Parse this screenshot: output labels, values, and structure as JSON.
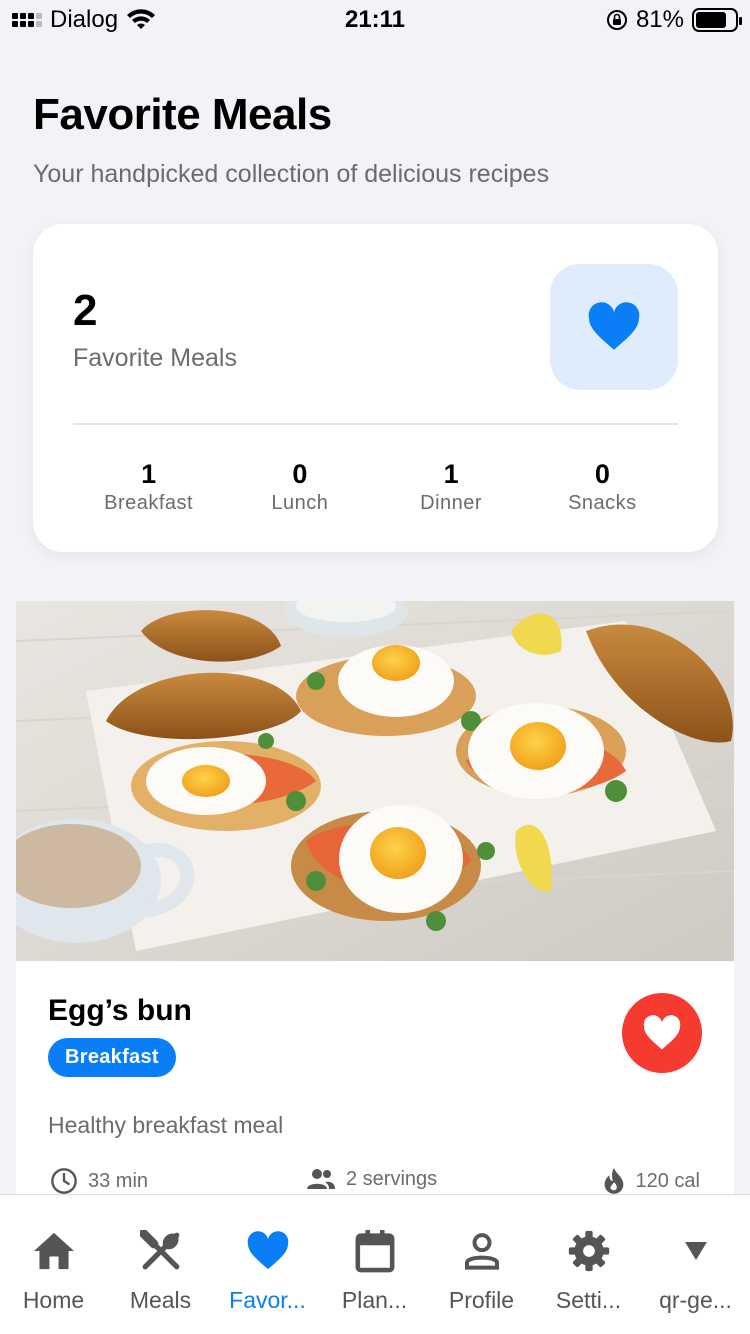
{
  "status_bar": {
    "carrier": "Dialog",
    "time": "21:11",
    "battery_percent": "81%",
    "battery_level": 0.81
  },
  "header": {
    "title": "Favorite Meals",
    "subtitle": "Your handpicked collection of delicious recipes"
  },
  "summary": {
    "count": "2",
    "count_label": "Favorite Meals",
    "stats": [
      {
        "value": "1",
        "label": "Breakfast"
      },
      {
        "value": "0",
        "label": "Lunch"
      },
      {
        "value": "1",
        "label": "Dinner"
      },
      {
        "value": "0",
        "label": "Snacks"
      }
    ]
  },
  "meals": [
    {
      "title": "Egg’s bun",
      "category": "Breakfast",
      "description": "Healthy breakfast meal",
      "time": "33 min",
      "servings": "2 servings",
      "calories": "120 cal",
      "favorite": true
    }
  ],
  "tabs": [
    {
      "label": "Home",
      "icon": "home-icon"
    },
    {
      "label": "Meals",
      "icon": "fork-knife-icon"
    },
    {
      "label": "Favor...",
      "icon": "heart-icon",
      "active": true
    },
    {
      "label": "Plan...",
      "icon": "calendar-icon"
    },
    {
      "label": "Profile",
      "icon": "person-icon"
    },
    {
      "label": "Setti...",
      "icon": "gear-icon"
    },
    {
      "label": "qr-ge...",
      "icon": "triangle-down-icon"
    }
  ],
  "colors": {
    "accent": "#0a7ef7",
    "favorite_red": "#f53a2f",
    "background": "#f2f2f7",
    "heart_tile_bg": "#deecfc"
  }
}
